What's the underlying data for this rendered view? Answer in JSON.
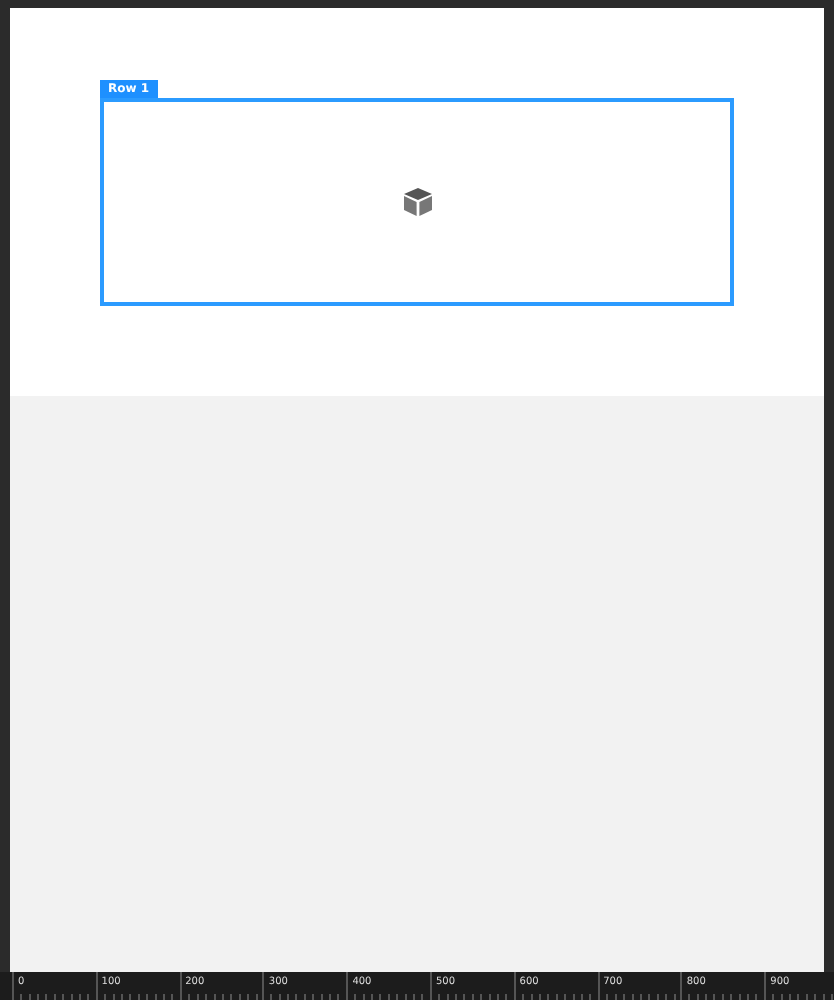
{
  "canvas": {
    "rows": [
      {
        "label": "Row 1"
      }
    ]
  },
  "ruler": {
    "ticks": [
      "0",
      "100",
      "200",
      "300",
      "400",
      "500",
      "600",
      "700",
      "800",
      "900"
    ]
  }
}
